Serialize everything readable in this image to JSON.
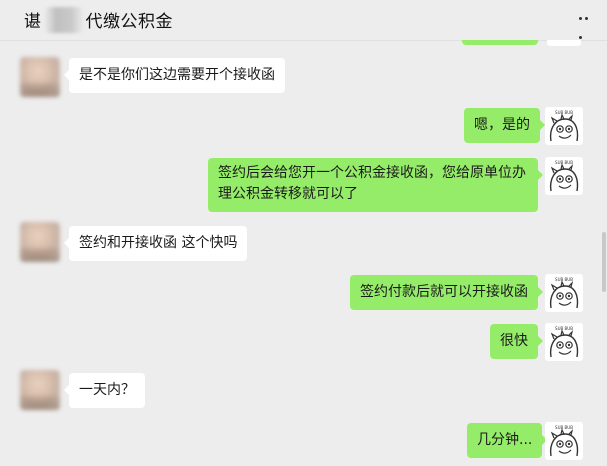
{
  "header": {
    "title_start": "谌",
    "title_end": "代缴公积金",
    "more_icon": "more-dots-icon"
  },
  "self_avatar": {
    "icon": "cartoon-face-avatar",
    "caption": "SUB BUB"
  },
  "contact_avatar": {
    "icon": "blurred-contact-avatar"
  },
  "messages": [
    {
      "side": "left",
      "text": "是不是你们这边需要开个接收函"
    },
    {
      "side": "right",
      "text": "嗯，是的"
    },
    {
      "side": "right",
      "text": "签约后会给您开一个公积金接收函，您给原单位办理公积金转移就可以了"
    },
    {
      "side": "left",
      "text": "签约和开接收函 这个快吗"
    },
    {
      "side": "right",
      "text": "签约付款后就可以开接收函"
    },
    {
      "side": "right",
      "text": "很快"
    },
    {
      "side": "left",
      "text": "一天内？"
    },
    {
      "side": "right",
      "text": "几分钟..."
    }
  ],
  "colors": {
    "background": "#ededed",
    "self_bubble": "#95ec69",
    "other_bubble": "#ffffff"
  }
}
